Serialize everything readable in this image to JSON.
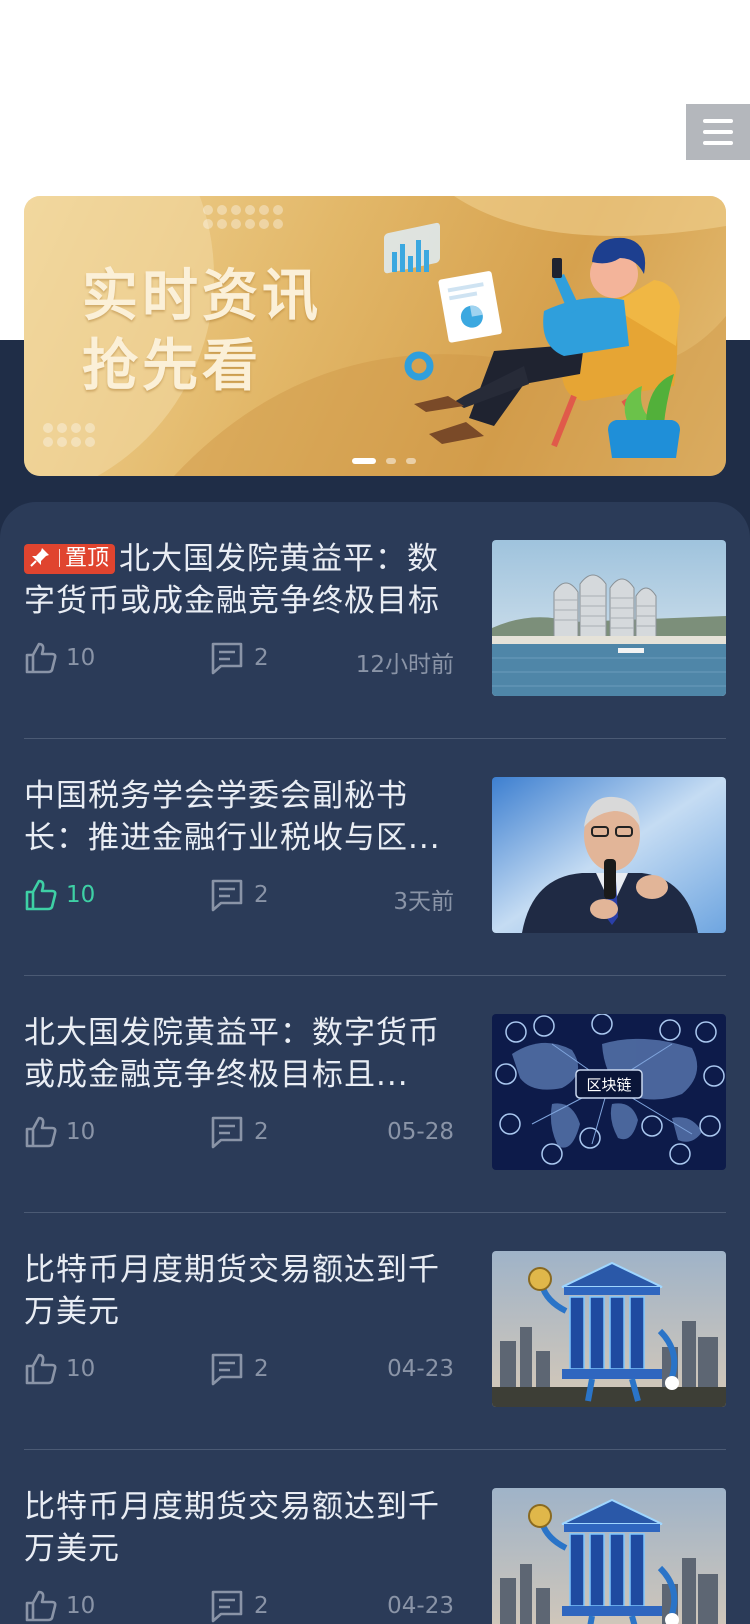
{
  "banner": {
    "headline_line1": "实时资讯",
    "headline_line2": "抢先看"
  },
  "news": [
    {
      "pinned": true,
      "badge_label": "置顶",
      "title": "北大国发院黄益平：数字货币或成金融竞争终极目标",
      "likes": "10",
      "liked": false,
      "comments": "2",
      "time": "12小时前",
      "image": "seaside-towers"
    },
    {
      "pinned": false,
      "title": "中国税务学会学委会副秘书长：推进金融行业税收与区...",
      "likes": "10",
      "liked": true,
      "comments": "2",
      "time": "3天前",
      "image": "speaker-portrait"
    },
    {
      "pinned": false,
      "title": "北大国发院黄益平：数字货币或成金融竞争终极目标且...",
      "likes": "10",
      "liked": false,
      "comments": "2",
      "time": "05-28",
      "image": "blockchain-map",
      "image_label": "区块链"
    },
    {
      "pinned": false,
      "title": "比特币月度期货交易额达到千万美元",
      "likes": "10",
      "liked": false,
      "comments": "2",
      "time": "04-23",
      "image": "bank-coin"
    },
    {
      "pinned": false,
      "title": "比特币月度期货交易额达到千万美元",
      "likes": "10",
      "liked": false,
      "comments": "2",
      "time": "04-23",
      "image": "bank-coin"
    }
  ],
  "colors": {
    "panel": "#2b3b58",
    "navy": "#1f2d47",
    "like_active": "#3ed0a5",
    "badge": "#e0442f",
    "banner_gold": "#e2b768"
  },
  "icons": [
    "menu-icon",
    "pin-icon",
    "thumbs-up-icon",
    "comment-icon"
  ]
}
